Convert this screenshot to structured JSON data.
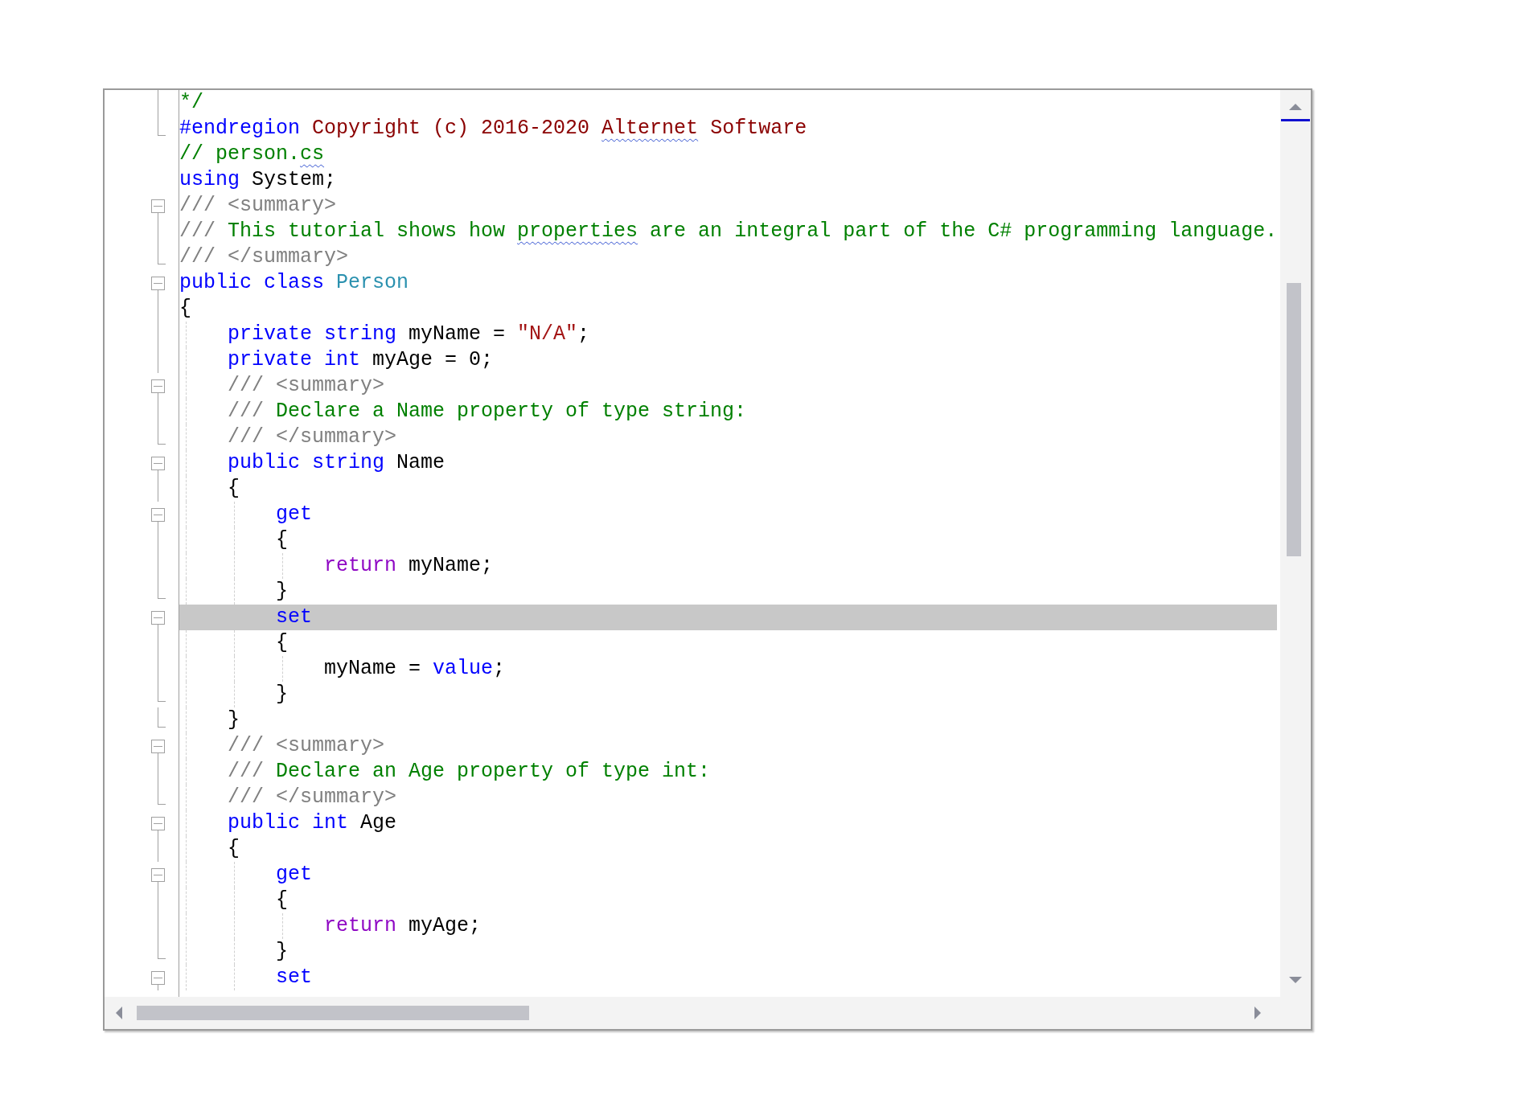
{
  "editor": {
    "lines": [
      {
        "kind": "inside",
        "selected": false,
        "tokens": [
          {
            "kind": "comment",
            "text": "*/"
          }
        ]
      },
      {
        "kind": "end",
        "selected": false,
        "tokens": [
          {
            "kind": "keyword",
            "text": "#endregion"
          },
          {
            "kind": "preproc",
            "text": " Copyright (c) 2016-2020 "
          },
          {
            "kind": "preproc",
            "text": "Alternet",
            "misspelled": true
          },
          {
            "kind": "preproc",
            "text": " Software"
          }
        ]
      },
      {
        "kind": "none",
        "selected": false,
        "tokens": [
          {
            "kind": "comment",
            "text": "// person."
          },
          {
            "kind": "comment",
            "text": "cs",
            "misspelled": true
          }
        ]
      },
      {
        "kind": "none",
        "selected": false,
        "tokens": [
          {
            "kind": "keyword",
            "text": "using"
          },
          {
            "kind": "plain",
            "text": " System;"
          }
        ]
      },
      {
        "kind": "start",
        "selected": false,
        "tokens": [
          {
            "kind": "doc",
            "text": "/// <summary>"
          }
        ]
      },
      {
        "kind": "inside",
        "selected": false,
        "tokens": [
          {
            "kind": "doc",
            "text": "/// "
          },
          {
            "kind": "comment",
            "text": "This tutorial shows how "
          },
          {
            "kind": "comment",
            "text": "properties",
            "misspelled": true
          },
          {
            "kind": "comment",
            "text": " are an integral part of the C# programming language."
          }
        ]
      },
      {
        "kind": "end",
        "selected": false,
        "tokens": [
          {
            "kind": "doc",
            "text": "/// </summary>"
          }
        ]
      },
      {
        "kind": "start",
        "selected": false,
        "tokens": [
          {
            "kind": "keyword",
            "text": "public class "
          },
          {
            "kind": "type",
            "text": "Person"
          }
        ]
      },
      {
        "kind": "inside",
        "selected": false,
        "tokens": [
          {
            "kind": "plain",
            "text": "{"
          }
        ]
      },
      {
        "kind": "inside",
        "selected": false,
        "tokens": [
          {
            "kind": "keyword",
            "text": "    private string"
          },
          {
            "kind": "plain",
            "text": " myName = "
          },
          {
            "kind": "string",
            "text": "\"N/A\""
          },
          {
            "kind": "plain",
            "text": ";"
          }
        ]
      },
      {
        "kind": "inside",
        "selected": false,
        "tokens": [
          {
            "kind": "keyword",
            "text": "    private int"
          },
          {
            "kind": "plain",
            "text": " myAge = 0;"
          }
        ]
      },
      {
        "kind": "start",
        "selected": false,
        "tokens": [
          {
            "kind": "doc",
            "text": "    /// <summary>"
          }
        ]
      },
      {
        "kind": "inside",
        "selected": false,
        "tokens": [
          {
            "kind": "doc",
            "text": "    /// "
          },
          {
            "kind": "comment",
            "text": "Declare a Name property of type string:"
          }
        ]
      },
      {
        "kind": "end",
        "selected": false,
        "tokens": [
          {
            "kind": "doc",
            "text": "    /// </summary>"
          }
        ]
      },
      {
        "kind": "start",
        "selected": false,
        "tokens": [
          {
            "kind": "keyword",
            "text": "    public string"
          },
          {
            "kind": "plain",
            "text": " Name"
          }
        ]
      },
      {
        "kind": "inside",
        "selected": false,
        "tokens": [
          {
            "kind": "plain",
            "text": "    {"
          }
        ]
      },
      {
        "kind": "start",
        "selected": false,
        "tokens": [
          {
            "kind": "keyword",
            "text": "        get"
          }
        ]
      },
      {
        "kind": "inside",
        "selected": false,
        "tokens": [
          {
            "kind": "plain",
            "text": "        {"
          }
        ]
      },
      {
        "kind": "inside",
        "selected": false,
        "tokens": [
          {
            "kind": "control",
            "text": "            return"
          },
          {
            "kind": "plain",
            "text": " myName;"
          }
        ]
      },
      {
        "kind": "end",
        "selected": false,
        "tokens": [
          {
            "kind": "plain",
            "text": "        }"
          }
        ]
      },
      {
        "kind": "start",
        "selected": true,
        "tokens": [
          {
            "kind": "keyword",
            "text": "        set"
          }
        ]
      },
      {
        "kind": "inside",
        "selected": false,
        "tokens": [
          {
            "kind": "plain",
            "text": "        {"
          }
        ]
      },
      {
        "kind": "inside",
        "selected": false,
        "tokens": [
          {
            "kind": "plain",
            "text": "            myName = "
          },
          {
            "kind": "keyword",
            "text": "value"
          },
          {
            "kind": "plain",
            "text": ";"
          }
        ]
      },
      {
        "kind": "end",
        "selected": false,
        "tokens": [
          {
            "kind": "plain",
            "text": "        }"
          }
        ]
      },
      {
        "kind": "end",
        "selected": false,
        "tokens": [
          {
            "kind": "plain",
            "text": "    }"
          }
        ]
      },
      {
        "kind": "start",
        "selected": false,
        "tokens": [
          {
            "kind": "doc",
            "text": "    /// <summary>"
          }
        ]
      },
      {
        "kind": "inside",
        "selected": false,
        "tokens": [
          {
            "kind": "doc",
            "text": "    /// "
          },
          {
            "kind": "comment",
            "text": "Declare an Age property of type int:"
          }
        ]
      },
      {
        "kind": "end",
        "selected": false,
        "tokens": [
          {
            "kind": "doc",
            "text": "    /// </summary>"
          }
        ]
      },
      {
        "kind": "start",
        "selected": false,
        "tokens": [
          {
            "kind": "keyword",
            "text": "    public int"
          },
          {
            "kind": "plain",
            "text": " Age"
          }
        ]
      },
      {
        "kind": "inside",
        "selected": false,
        "tokens": [
          {
            "kind": "plain",
            "text": "    {"
          }
        ]
      },
      {
        "kind": "start",
        "selected": false,
        "tokens": [
          {
            "kind": "keyword",
            "text": "        get"
          }
        ]
      },
      {
        "kind": "inside",
        "selected": false,
        "tokens": [
          {
            "kind": "plain",
            "text": "        {"
          }
        ]
      },
      {
        "kind": "inside",
        "selected": false,
        "tokens": [
          {
            "kind": "control",
            "text": "            return"
          },
          {
            "kind": "plain",
            "text": " myAge;"
          }
        ]
      },
      {
        "kind": "end",
        "selected": false,
        "tokens": [
          {
            "kind": "plain",
            "text": "        }"
          }
        ]
      },
      {
        "kind": "start",
        "selected": false,
        "tokens": [
          {
            "kind": "keyword",
            "text": "        set"
          }
        ]
      }
    ]
  }
}
